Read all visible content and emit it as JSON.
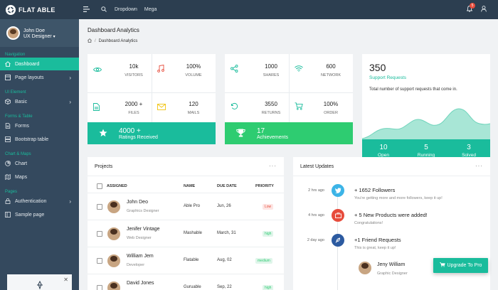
{
  "brand": {
    "name": "FLAT ABLE"
  },
  "topbar": {
    "links": [
      "Dropdown",
      "Mega"
    ],
    "notif_count": "5"
  },
  "user": {
    "name": "John Doe",
    "role": "UX Designer"
  },
  "nav": {
    "cap_navigation": "Navigation",
    "dashboard": "Dashboard",
    "page_layouts": "Page layouts",
    "cap_ui": "UI Element",
    "basic": "Basic",
    "cap_forms": "Forms & Table",
    "forms": "Forms",
    "bootstrap_table": "Bootstrap table",
    "cap_charts": "Chart & Maps",
    "chart": "Chart",
    "maps": "Maps",
    "cap_pages": "Pages",
    "authentication": "Authentication",
    "sample_page": "Sample page"
  },
  "header": {
    "title": "Dashboard Analytics",
    "crumb": "Dashboard Analytics"
  },
  "stats1": [
    {
      "value": "10k",
      "label": "VISITORS"
    },
    {
      "value": "100%",
      "label": "VOLUME"
    },
    {
      "value": "2000 +",
      "label": "FILES"
    },
    {
      "value": "120",
      "label": "MAILS"
    }
  ],
  "stats2": [
    {
      "value": "1000",
      "label": "SHARES"
    },
    {
      "value": "600",
      "label": "NETWORK"
    },
    {
      "value": "3550",
      "label": "RETURNS"
    },
    {
      "value": "100%",
      "label": "ORDER"
    }
  ],
  "support": {
    "value": "350",
    "title": "Support Requests",
    "desc": "Total number of support requests that come in.",
    "open": "10",
    "open_label": "Open",
    "running": "5",
    "running_label": "Running",
    "solved": "3",
    "solved_label": "Solved"
  },
  "ratings": {
    "value": "4000 +",
    "label": "Ratings Received"
  },
  "achievements": {
    "value": "17",
    "label": "Achievements"
  },
  "projects": {
    "title": "Projects",
    "headers": [
      "ASSIGNED",
      "NAME",
      "DUE DATE",
      "PRIORITY"
    ],
    "rows": [
      {
        "name": "John Deo",
        "role": "Graphics Designer",
        "project": "Able Pro",
        "due": "Jun, 26",
        "priority": "Low"
      },
      {
        "name": "Jenifer Vintage",
        "role": "Web Designer",
        "project": "Mashable",
        "due": "March, 31",
        "priority": "high"
      },
      {
        "name": "William Jem",
        "role": "Developer",
        "project": "Flatable",
        "due": "Aug, 02",
        "priority": "medium"
      },
      {
        "name": "David Jones",
        "role": "",
        "project": "Guruable",
        "due": "Sep, 22",
        "priority": "high"
      }
    ]
  },
  "updates": {
    "title": "Latest Updates",
    "items": [
      {
        "time": "2 hrs ago",
        "title": "+ 1652 Followers",
        "sub": "You're getting more and more followers, keep it up!"
      },
      {
        "time": "4 hrs ago",
        "title": "+ 5 New Products were added!",
        "sub": "Congratulations!"
      },
      {
        "time": "2 day ago",
        "title": "+1 Friend Requests",
        "sub": "This is great, keep it up!"
      }
    ],
    "friend": {
      "name": "Jeny William",
      "role": "Graphic Designer"
    }
  },
  "upgrade": {
    "label": "Upgrade To Pro"
  },
  "colors": {
    "accent": "#1abc9c",
    "green": "#2ecc71",
    "topbar": "#2c3e50",
    "sidebar": "#34495e"
  }
}
